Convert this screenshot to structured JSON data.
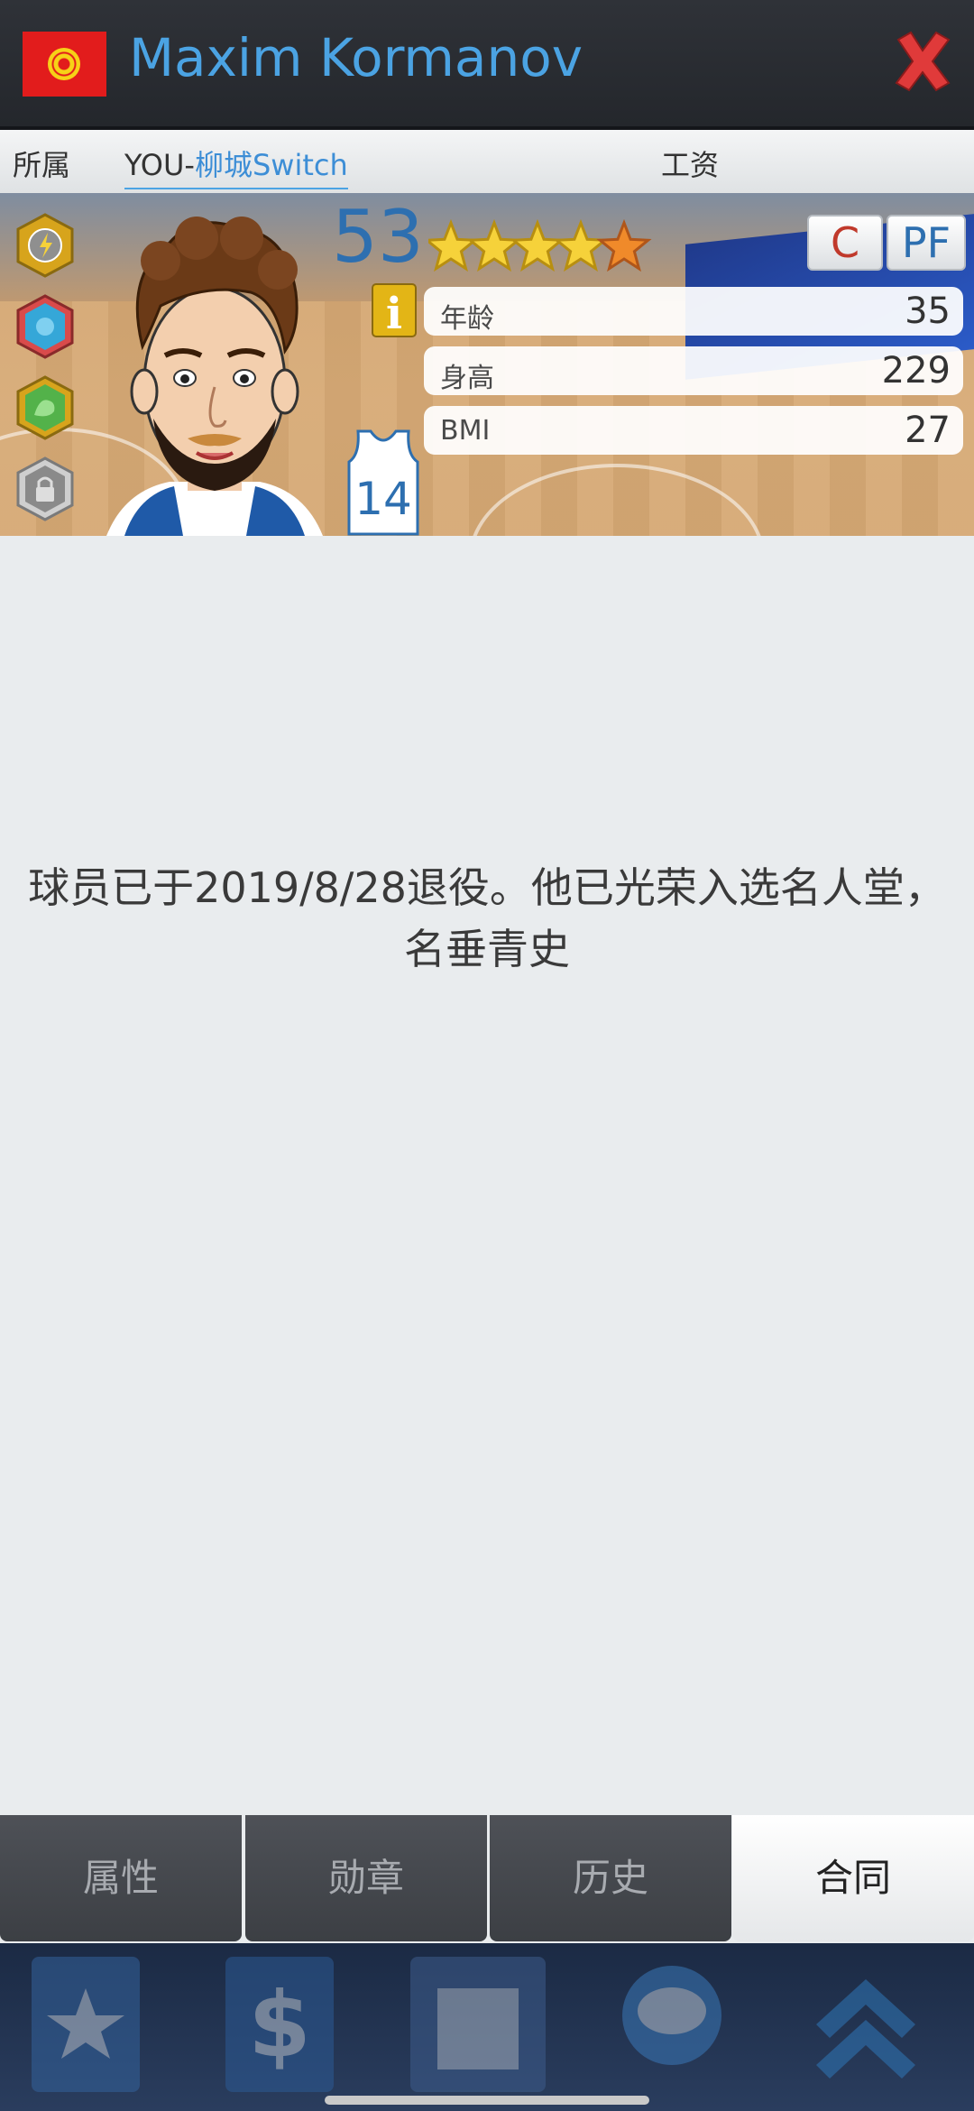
{
  "header": {
    "player_name": "Maxim Kormanov",
    "flag_icon": "kyrgyzstan-flag-icon",
    "close_icon": "close-x-icon"
  },
  "info_bar": {
    "affiliation_label": "所属",
    "team_prefix": "YOU-",
    "team_name": "柳城Switch",
    "salary_label": "工资"
  },
  "player_card": {
    "rating": "53",
    "stars": {
      "filled": 4,
      "half": 0,
      "orange": 1,
      "total": 5
    },
    "positions": [
      {
        "label": "C",
        "color": "#c0392b"
      },
      {
        "label": "PF",
        "color": "#2d6fb0"
      }
    ],
    "jersey_number": "14",
    "info_icon": "info-icon",
    "badges": [
      "lightning-badge-icon",
      "brain-badge-icon",
      "muscle-badge-icon",
      "lock-badge-icon"
    ],
    "stats": [
      {
        "label": "年龄",
        "value": "35"
      },
      {
        "label": "身高",
        "value": "229"
      },
      {
        "label": "BMI",
        "value": "27"
      }
    ]
  },
  "main": {
    "retired_message": "球员已于2019/8/28退役。他已光荣入选名人堂，名垂青史"
  },
  "tabs": [
    {
      "label": "属性",
      "active": false
    },
    {
      "label": "勋章",
      "active": false
    },
    {
      "label": "历史",
      "active": false
    },
    {
      "label": "合同",
      "active": true
    }
  ],
  "bottom_nav": {
    "icons": [
      "star-icon",
      "dollar-icon",
      "building-icon",
      "chat-icon",
      "chevron-up-icon"
    ]
  },
  "colors": {
    "accent": "#4ba3e3",
    "titlebar": "#2a2d32",
    "close_red": "#e03a3a"
  }
}
